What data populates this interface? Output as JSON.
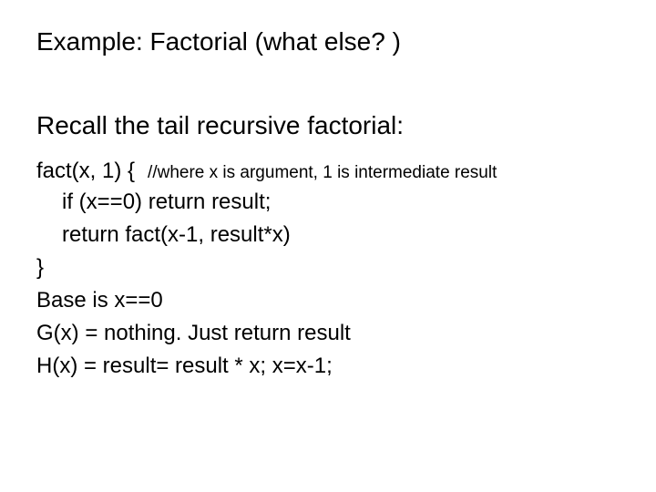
{
  "title": "Example: Factorial (what else? )",
  "subtitle": "Recall the tail recursive factorial:",
  "signature": "fact(x, 1) {",
  "comment": "//where x is argument, 1 is intermediate result",
  "body": {
    "line1": "if (x==0) return result;",
    "line2": "return fact(x-1, result*x)"
  },
  "close": "}",
  "notes": {
    "base": "Base is x==0",
    "g": "G(x) = nothing. Just return result",
    "h": "H(x) = result= result * x; x=x-1;"
  }
}
